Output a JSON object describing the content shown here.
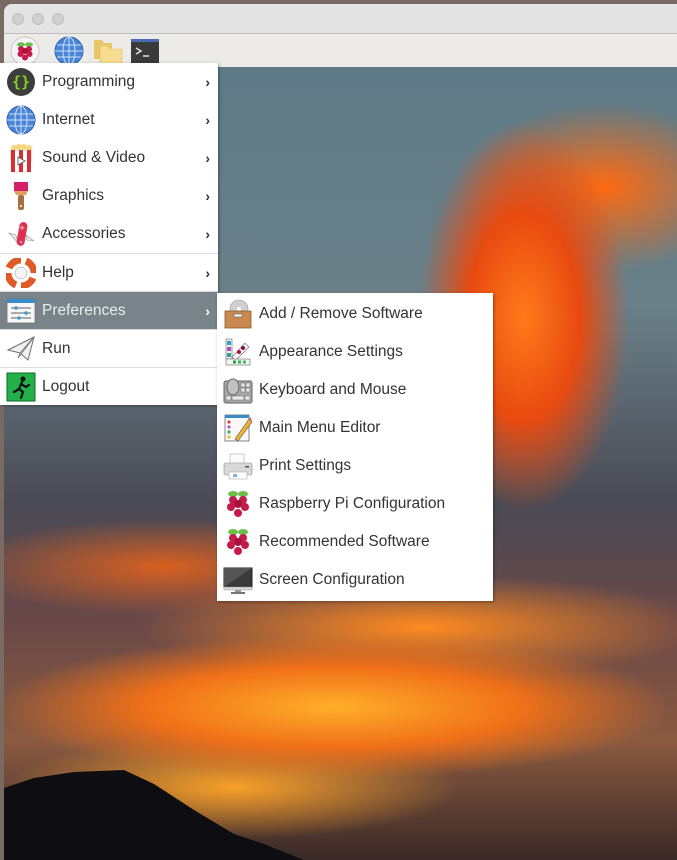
{
  "window": {
    "traffic_lights": [
      "close",
      "minimize",
      "zoom"
    ]
  },
  "taskbar": {
    "launchers": [
      {
        "name": "raspberry-menu",
        "icon": "raspberry-icon"
      },
      {
        "name": "web-browser",
        "icon": "globe-icon"
      },
      {
        "name": "file-manager",
        "icon": "folder-icon"
      },
      {
        "name": "terminal",
        "icon": "terminal-icon"
      }
    ]
  },
  "main_menu": {
    "items": [
      {
        "label": "Programming",
        "icon": "programming-braces-icon",
        "has_submenu": true
      },
      {
        "label": "Internet",
        "icon": "globe-icon",
        "has_submenu": true
      },
      {
        "label": "Sound & Video",
        "icon": "popcorn-icon",
        "has_submenu": true
      },
      {
        "label": "Graphics",
        "icon": "paintbrush-icon",
        "has_submenu": true
      },
      {
        "label": "Accessories",
        "icon": "pocket-knife-icon",
        "has_submenu": true
      },
      {
        "label": "Help",
        "icon": "lifebuoy-icon",
        "has_submenu": true
      },
      {
        "label": "Preferences",
        "icon": "preferences-sliders-icon",
        "has_submenu": true,
        "active": true
      },
      {
        "label": "Run",
        "icon": "paper-plane-icon",
        "has_submenu": false
      },
      {
        "label": "Logout",
        "icon": "exit-running-man-icon",
        "has_submenu": false
      }
    ],
    "arrow": "›"
  },
  "preferences_submenu": {
    "items": [
      {
        "label": "Add / Remove Software",
        "icon": "software-box-icon"
      },
      {
        "label": "Appearance Settings",
        "icon": "color-palette-icon"
      },
      {
        "label": "Keyboard and Mouse",
        "icon": "keyboard-mouse-icon"
      },
      {
        "label": "Main Menu Editor",
        "icon": "menu-editor-icon"
      },
      {
        "label": "Print Settings",
        "icon": "printer-icon"
      },
      {
        "label": "Raspberry Pi Configuration",
        "icon": "raspberry-icon"
      },
      {
        "label": "Recommended Software",
        "icon": "raspberry-icon"
      },
      {
        "label": "Screen Configuration",
        "icon": "monitor-icon"
      }
    ]
  },
  "colors": {
    "menu_active_bg": "#788489",
    "menu_text": "#333333",
    "raspberry_red": "#c51a4a",
    "leaf_green": "#6cc04a"
  }
}
